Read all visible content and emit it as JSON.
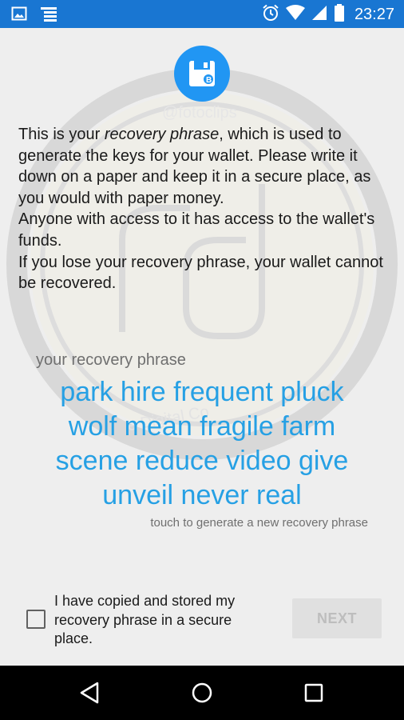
{
  "status_bar": {
    "time": "23:27",
    "icons": [
      "image-notification-icon",
      "list-notification-icon",
      "alarm-icon",
      "wifi-icon",
      "signal-icon",
      "battery-icon"
    ]
  },
  "watermark_text": {
    "top": "@fotoclips",
    "middle": "e Digital Co"
  },
  "intro": {
    "text_before": "This is your ",
    "emphasis": "recovery phrase",
    "text_after": ", which is used to generate the keys for your wallet. Please write it down on a paper and keep it in a secure place, as you would with paper money.",
    "line2": "Anyone with access to it has access to the wallet's funds.",
    "line3": "If you lose your recovery phrase, your wallet cannot be recovered."
  },
  "phrase": {
    "label": "your recovery phrase",
    "lines": [
      "park hire frequent pluck",
      "wolf mean fragile farm",
      "scene reduce video give",
      "unveil never real"
    ],
    "hint": "touch to generate a new recovery phrase"
  },
  "confirm": {
    "checkbox_label": "I have copied and stored my recovery phrase in a secure place.",
    "checked": false
  },
  "next_button": "NEXT",
  "colors": {
    "status_bar": "#1976d2",
    "accent": "#2196f3",
    "phrase_text": "#26a0e4"
  }
}
